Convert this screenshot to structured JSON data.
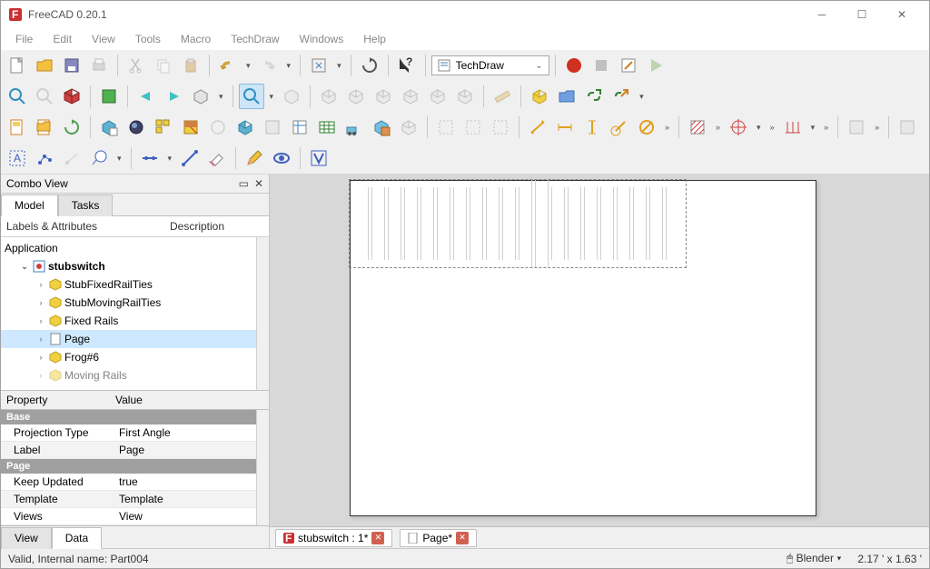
{
  "window": {
    "title": "FreeCAD 0.20.1"
  },
  "menu": [
    "File",
    "Edit",
    "View",
    "Tools",
    "Macro",
    "TechDraw",
    "Windows",
    "Help"
  ],
  "workbench": {
    "current": "TechDraw"
  },
  "combo": {
    "title": "Combo View",
    "tabs": [
      "Model",
      "Tasks"
    ],
    "headers": [
      "Labels & Attributes",
      "Description"
    ],
    "root_label": "Application",
    "tree": {
      "doc": "stubswitch",
      "items": [
        "StubFixedRailTies",
        "StubMovingRailTies",
        "Fixed Rails",
        "Page",
        "Frog#6",
        "Moving Rails"
      ],
      "selected_index": 3
    },
    "properties": {
      "headers": [
        "Property",
        "Value"
      ],
      "groups": [
        {
          "name": "Base",
          "rows": [
            {
              "k": "Projection Type",
              "v": "First Angle"
            },
            {
              "k": "Label",
              "v": "Page"
            }
          ]
        },
        {
          "name": "Page",
          "rows": [
            {
              "k": "Keep Updated",
              "v": "true"
            },
            {
              "k": "Template",
              "v": "Template"
            },
            {
              "k": "Views",
              "v": "View"
            }
          ]
        }
      ]
    },
    "bottom_tabs": [
      "View",
      "Data"
    ]
  },
  "doc_tabs": [
    {
      "label": "stubswitch : 1*"
    },
    {
      "label": "Page*"
    }
  ],
  "status": {
    "left": "Valid, Internal name: Part004",
    "nav_style": "Blender",
    "dims": "2.17 ' x 1.63 '"
  }
}
